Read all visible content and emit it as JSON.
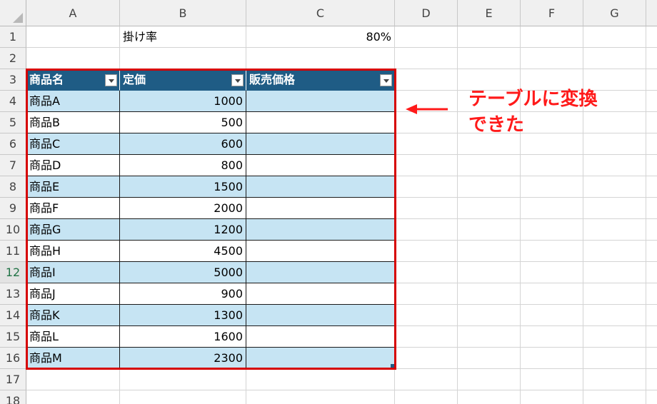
{
  "columns": [
    "A",
    "B",
    "C",
    "D",
    "E",
    "F",
    "G"
  ],
  "rows": [
    "1",
    "2",
    "3",
    "4",
    "5",
    "6",
    "7",
    "8",
    "9",
    "10",
    "11",
    "12",
    "13",
    "14",
    "15",
    "16",
    "17",
    "18"
  ],
  "sheet": {
    "b1_label": "掛け率",
    "c1_value": "80%"
  },
  "table": {
    "headers": [
      "商品名",
      "定価",
      "販売価格"
    ],
    "rows": [
      {
        "name": "商品A",
        "price": "1000",
        "sale": ""
      },
      {
        "name": "商品B",
        "price": "500",
        "sale": ""
      },
      {
        "name": "商品C",
        "price": "600",
        "sale": ""
      },
      {
        "name": "商品D",
        "price": "800",
        "sale": ""
      },
      {
        "name": "商品E",
        "price": "1500",
        "sale": ""
      },
      {
        "name": "商品F",
        "price": "2000",
        "sale": ""
      },
      {
        "name": "商品G",
        "price": "1200",
        "sale": ""
      },
      {
        "name": "商品H",
        "price": "4500",
        "sale": ""
      },
      {
        "name": "商品I",
        "price": "5000",
        "sale": ""
      },
      {
        "name": "商品J",
        "price": "900",
        "sale": ""
      },
      {
        "name": "商品K",
        "price": "1300",
        "sale": ""
      },
      {
        "name": "商品L",
        "price": "1600",
        "sale": ""
      },
      {
        "name": "商品M",
        "price": "2300",
        "sale": ""
      }
    ]
  },
  "annotation": {
    "line1": "テーブルに変換",
    "line2": "できた"
  },
  "colors": {
    "table_header": "#1f5c85",
    "band": "#c6e4f3",
    "highlight": "#d60000"
  }
}
